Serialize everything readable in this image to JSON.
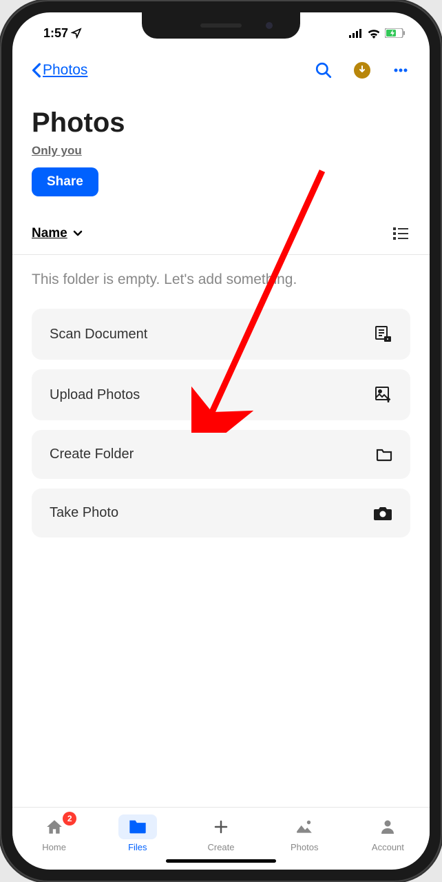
{
  "status": {
    "time": "1:57"
  },
  "nav": {
    "back_label": "Photos"
  },
  "page": {
    "title": "Photos",
    "access": "Only you",
    "share_label": "Share"
  },
  "sort": {
    "label": "Name"
  },
  "empty_state": {
    "text": "This folder is empty. Let's add something."
  },
  "actions": [
    {
      "label": "Scan Document",
      "icon": "scan-document-icon"
    },
    {
      "label": "Upload Photos",
      "icon": "upload-photos-icon"
    },
    {
      "label": "Create Folder",
      "icon": "create-folder-icon"
    },
    {
      "label": "Take Photo",
      "icon": "take-photo-icon"
    }
  ],
  "tabs": [
    {
      "label": "Home",
      "badge": "2"
    },
    {
      "label": "Files"
    },
    {
      "label": "Create"
    },
    {
      "label": "Photos"
    },
    {
      "label": "Account"
    }
  ]
}
